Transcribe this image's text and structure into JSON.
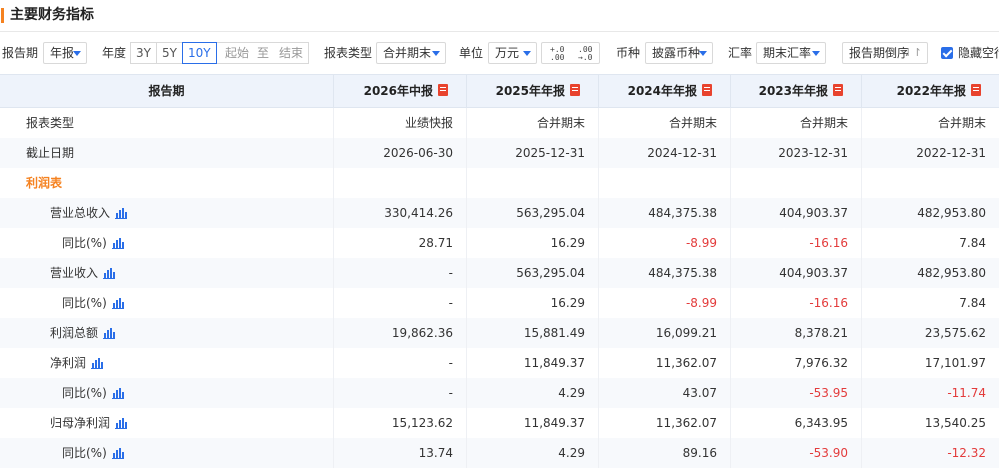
{
  "title": "主要财务指标",
  "filters": {
    "report_period_label": "报告期",
    "report_period_value": "年报",
    "year_label": "年度",
    "year_options": [
      "3Y",
      "5Y",
      "10Y"
    ],
    "year_active": "10Y",
    "range_start": "起始",
    "range_sep": "至",
    "range_end": "结束",
    "report_type_label": "报表类型",
    "report_type_value": "合并期末",
    "unit_label": "单位",
    "unit_value": "万元",
    "decimal_up_top": "+.0",
    "decimal_up_bottom": ".00",
    "decimal_down_top": ".00",
    "decimal_down_bottom": "→.0",
    "currency_label": "币种",
    "currency_value": "披露币种",
    "rate_label": "汇率",
    "rate_value": "期末汇率",
    "sort_label": "报告期倒序",
    "sort_icon": "⇃↾",
    "hide_empty_label": "隐藏空行",
    "hide_empty_checked": true
  },
  "table": {
    "header_first": "报告期",
    "columns": [
      "2026年中报",
      "2025年年报",
      "2024年年报",
      "2023年年报",
      "2022年年报"
    ],
    "rows": [
      {
        "label": "报表类型",
        "indent": 1,
        "chart": false,
        "values": [
          "业绩快报",
          "合并期末",
          "合并期末",
          "合并期末",
          "合并期末"
        ]
      },
      {
        "label": "截止日期",
        "indent": 1,
        "chart": false,
        "values": [
          "2026-06-30",
          "2025-12-31",
          "2024-12-31",
          "2023-12-31",
          "2022-12-31"
        ]
      },
      {
        "label": "利润表",
        "indent": 1,
        "chart": false,
        "section": true,
        "values": [
          "",
          "",
          "",
          "",
          ""
        ]
      },
      {
        "label": "营业总收入",
        "indent": 2,
        "chart": true,
        "values": [
          "330,414.26",
          "563,295.04",
          "484,375.38",
          "404,903.37",
          "482,953.80"
        ]
      },
      {
        "label": "同比(%)",
        "indent": 3,
        "chart": true,
        "values": [
          "28.71",
          "16.29",
          "-8.99",
          "-16.16",
          "7.84"
        ]
      },
      {
        "label": "营业收入",
        "indent": 2,
        "chart": true,
        "values": [
          "-",
          "563,295.04",
          "484,375.38",
          "404,903.37",
          "482,953.80"
        ]
      },
      {
        "label": "同比(%)",
        "indent": 3,
        "chart": true,
        "values": [
          "-",
          "16.29",
          "-8.99",
          "-16.16",
          "7.84"
        ]
      },
      {
        "label": "利润总额",
        "indent": 2,
        "chart": true,
        "values": [
          "19,862.36",
          "15,881.49",
          "16,099.21",
          "8,378.21",
          "23,575.62"
        ]
      },
      {
        "label": "净利润",
        "indent": 2,
        "chart": true,
        "values": [
          "-",
          "11,849.37",
          "11,362.07",
          "7,976.32",
          "17,101.97"
        ]
      },
      {
        "label": "同比(%)",
        "indent": 3,
        "chart": true,
        "values": [
          "-",
          "4.29",
          "43.07",
          "-53.95",
          "-11.74"
        ]
      },
      {
        "label": "归母净利润",
        "indent": 2,
        "chart": true,
        "values": [
          "15,123.62",
          "11,849.37",
          "11,362.07",
          "6,343.95",
          "13,540.25"
        ]
      },
      {
        "label": "同比(%)",
        "indent": 3,
        "chart": true,
        "values": [
          "13.74",
          "4.29",
          "89.16",
          "-53.90",
          "-12.32"
        ]
      }
    ]
  },
  "colors": {
    "accent": "#2a6ee8",
    "section": "#f58220",
    "negative": "#e33b3b",
    "header_bg": "#eef3fb"
  }
}
